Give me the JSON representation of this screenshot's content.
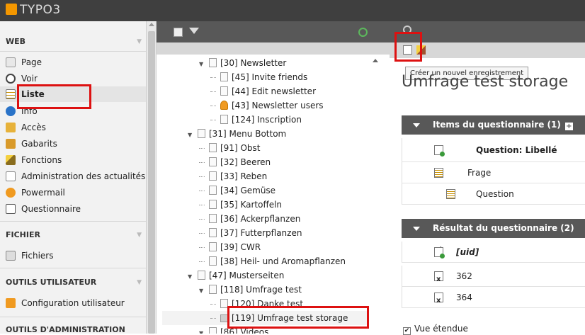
{
  "app": {
    "logo": "TYPO3"
  },
  "sidebar": {
    "sections": [
      {
        "label": "WEB",
        "items": [
          {
            "label": "Page",
            "icon": "page-icon"
          },
          {
            "label": "Voir",
            "icon": "eye-icon"
          },
          {
            "label": "Liste",
            "icon": "list-icon",
            "selected": true
          },
          {
            "label": "Info",
            "icon": "info-icon"
          },
          {
            "label": "Accès",
            "icon": "lock-icon"
          },
          {
            "label": "Gabarits",
            "icon": "template-icon"
          },
          {
            "label": "Fonctions",
            "icon": "wand-icon"
          },
          {
            "label": "Administration des actualités",
            "icon": "news-icon"
          },
          {
            "label": "Powermail",
            "icon": "powermail-icon"
          },
          {
            "label": "Questionnaire",
            "icon": "questionnaire-icon"
          }
        ]
      },
      {
        "label": "FICHIER",
        "items": [
          {
            "label": "Fichiers",
            "icon": "folder-icon"
          }
        ]
      },
      {
        "label": "OUTILS UTILISATEUR",
        "items": [
          {
            "label": "Configuration utilisateur",
            "icon": "user-settings-icon"
          }
        ]
      },
      {
        "label": "OUTILS D'ADMINISTRATION",
        "items": []
      }
    ]
  },
  "tree": {
    "nodes": [
      {
        "label": "[30] Newsletter",
        "indent": 1,
        "expand": "▼"
      },
      {
        "label": "[45] Invite friends",
        "indent": 2
      },
      {
        "label": "[44] Edit newsletter",
        "indent": 2
      },
      {
        "label": "[43] Newsletter users",
        "indent": 2,
        "icon": "user"
      },
      {
        "label": "[124] Inscription",
        "indent": 2
      },
      {
        "label": "[31] Menu Bottom",
        "indent": 0,
        "expand": "▼"
      },
      {
        "label": "[91] Obst",
        "indent": 1
      },
      {
        "label": "[32] Beeren",
        "indent": 1
      },
      {
        "label": "[33] Reben",
        "indent": 1
      },
      {
        "label": "[34] Gemüse",
        "indent": 1
      },
      {
        "label": "[35] Kartoffeln",
        "indent": 1
      },
      {
        "label": "[36] Ackerpflanzen",
        "indent": 1
      },
      {
        "label": "[37] Futterpflanzen",
        "indent": 1
      },
      {
        "label": "[39] CWR",
        "indent": 1
      },
      {
        "label": "[38] Heil- und Aromapflanzen",
        "indent": 1
      },
      {
        "label": "[47] Musterseiten",
        "indent": 0,
        "expand": "▼"
      },
      {
        "label": "[118] Umfrage test",
        "indent": 1,
        "expand": "▼"
      },
      {
        "label": "[120] Danke test",
        "indent": 2
      },
      {
        "label": "[119] Umfrage test storage",
        "indent": 2,
        "selected": true,
        "icon": "folder"
      },
      {
        "label": "[86] Videos",
        "indent": 1,
        "expand": "▼"
      }
    ]
  },
  "content": {
    "tooltip": "Créer un nouvel enregistrement",
    "heading": "Umfrage test storage",
    "panel1": {
      "title": "Items du questionnaire (1)",
      "plus": "+",
      "column": "Question: Libellé",
      "rows": [
        {
          "label": "Frage"
        },
        {
          "label": "Question"
        }
      ]
    },
    "panel2": {
      "title": "Résultat du questionnaire (2)",
      "plus": "+",
      "column": "[uid]",
      "rows": [
        {
          "label": "362"
        },
        {
          "label": "364"
        }
      ]
    },
    "vue": {
      "label": "Vue étendue",
      "checked": "✔"
    }
  },
  "colors": {
    "highlight": "#d11111",
    "toolbar": "#585858",
    "topbar": "#3f3f3f"
  }
}
